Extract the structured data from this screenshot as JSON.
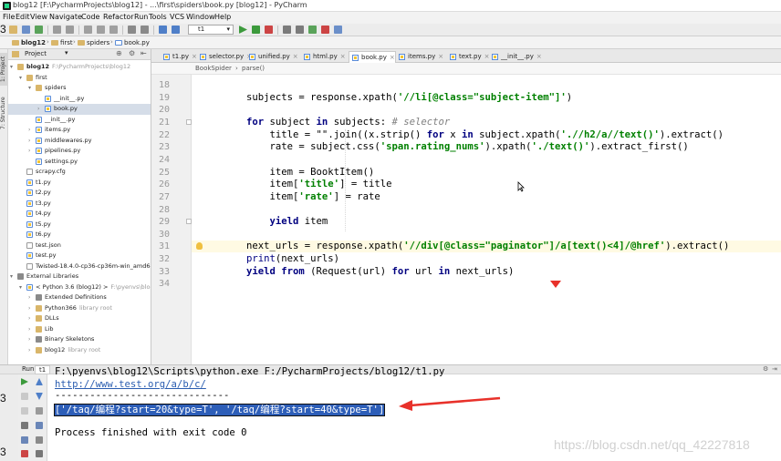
{
  "window": {
    "title": "blog12 [F:\\PycharmProjects\\blog12] - ...\\first\\spiders\\book.py [blog12] - PyCharm"
  },
  "menu": [
    "File",
    "Edit",
    "View",
    "Navigate",
    "Code",
    "Refactor",
    "Run",
    "Tools",
    "VCS",
    "Window",
    "Help"
  ],
  "toolbar": {
    "run_config": "t1"
  },
  "navbar": {
    "crumbs": [
      "blog12",
      "first",
      "spiders",
      "book.py"
    ]
  },
  "left_strip": {
    "tabs": [
      "1: Project",
      "7: Structure"
    ]
  },
  "project_panel": {
    "header": "Project",
    "tree": [
      {
        "label": "blog12",
        "suffix": "F:\\PycharmProjects\\blog12",
        "icon": "folder-icon",
        "depth": 0,
        "arrow": "down"
      },
      {
        "label": "first",
        "icon": "folder-icon",
        "depth": 1,
        "arrow": "down"
      },
      {
        "label": "spiders",
        "icon": "folder-icon",
        "depth": 2,
        "arrow": "down"
      },
      {
        "label": "__init__.py",
        "icon": "python-file-icon",
        "depth": 3
      },
      {
        "label": "book.py",
        "icon": "python-file-icon",
        "depth": 3,
        "selected": true,
        "arrow": "right"
      },
      {
        "label": "__init__.py",
        "icon": "python-file-icon",
        "depth": 2
      },
      {
        "label": "items.py",
        "icon": "python-file-icon",
        "depth": 2,
        "arrow": "right"
      },
      {
        "label": "middlewares.py",
        "icon": "python-file-icon",
        "depth": 2,
        "arrow": "right"
      },
      {
        "label": "pipelines.py",
        "icon": "python-file-icon",
        "depth": 2,
        "arrow": "right"
      },
      {
        "label": "settings.py",
        "icon": "python-file-icon",
        "depth": 2
      },
      {
        "label": "scrapy.cfg",
        "icon": "file-icon",
        "depth": 1
      },
      {
        "label": "t1.py",
        "icon": "python-file-icon",
        "depth": 1
      },
      {
        "label": "t2.py",
        "icon": "python-file-icon",
        "depth": 1
      },
      {
        "label": "t3.py",
        "icon": "python-file-icon",
        "depth": 1
      },
      {
        "label": "t4.py",
        "icon": "python-file-icon",
        "depth": 1
      },
      {
        "label": "t5.py",
        "icon": "python-file-icon",
        "depth": 1
      },
      {
        "label": "t6.py",
        "icon": "python-file-icon",
        "depth": 1
      },
      {
        "label": "test.json",
        "icon": "file-icon",
        "depth": 1
      },
      {
        "label": "test.py",
        "icon": "python-file-icon",
        "depth": 1
      },
      {
        "label": "Twisted-18.4.0-cp36-cp36m-win_amd64.whl",
        "icon": "file-icon",
        "depth": 1
      },
      {
        "label": "External Libraries",
        "icon": "library-icon",
        "depth": 0,
        "arrow": "down"
      },
      {
        "label": "< Python 3.6 (blog12) >",
        "suffix": "F:\\pyenvs\\blog12\\",
        "icon": "python-sdk-icon",
        "depth": 1,
        "arrow": "down"
      },
      {
        "label": "Extended Definitions",
        "icon": "library-icon",
        "depth": 2,
        "arrow": "right"
      },
      {
        "label": "Python366",
        "suffix": "library root",
        "icon": "folder-icon",
        "depth": 2,
        "arrow": "right"
      },
      {
        "label": "DLLs",
        "icon": "folder-icon",
        "depth": 2,
        "arrow": "right"
      },
      {
        "label": "Lib",
        "icon": "folder-icon",
        "depth": 2,
        "arrow": "right"
      },
      {
        "label": "Binary Skeletons",
        "icon": "library-icon",
        "depth": 2,
        "arrow": "right"
      },
      {
        "label": "blog12",
        "suffix": "library root",
        "icon": "folder-icon",
        "depth": 2,
        "arrow": "right"
      }
    ]
  },
  "editor": {
    "tabs": [
      {
        "label": "t1.py",
        "active": false
      },
      {
        "label": "selector.py",
        "active": false
      },
      {
        "label": "unified.py",
        "active": false
      },
      {
        "label": "html.py",
        "active": false
      },
      {
        "label": "book.py",
        "active": true
      },
      {
        "label": "items.py",
        "active": false
      },
      {
        "label": "text.py",
        "active": false
      },
      {
        "label": "__init__.py",
        "active": false
      }
    ],
    "breadcrumb": [
      "BookSpider",
      "parse()"
    ],
    "lines": [
      {
        "n": "18",
        "code": ""
      },
      {
        "n": "19",
        "code": "subjects = response.xpath('//li[@class=\"subject-item\"]')"
      },
      {
        "n": "20",
        "code": ""
      },
      {
        "n": "21",
        "code": "for subject in subjects: # selector"
      },
      {
        "n": "22",
        "code": "    title = \"\".join((x.strip() for x in subject.xpath('.//h2/a//text()').extract()"
      },
      {
        "n": "23",
        "code": "    rate = subject.css('span.rating_nums').xpath('./text()').extract_first()"
      },
      {
        "n": "24",
        "code": ""
      },
      {
        "n": "25",
        "code": "    item = BooktItem()"
      },
      {
        "n": "26",
        "code": "    item['title'] = title"
      },
      {
        "n": "27",
        "code": "    item['rate'] = rate"
      },
      {
        "n": "28",
        "code": ""
      },
      {
        "n": "29",
        "code": "    yield item"
      },
      {
        "n": "30",
        "code": ""
      },
      {
        "n": "31",
        "code": "next_urls = response.xpath('//div[@class=\"paginator\"]/a[text()<4]/@href').extract()"
      },
      {
        "n": "32",
        "code": "print(next_urls)"
      },
      {
        "n": "33",
        "code": "yield from (Request(url) for url in next_urls)"
      },
      {
        "n": "34",
        "code": ""
      }
    ]
  },
  "run_panel": {
    "header": "Run",
    "tab_label": "t1",
    "output": [
      "F:\\pyenvs\\blog12\\Scripts\\python.exe F:/PycharmProjects/blog12/t1.py",
      "http://www.test.org/a/b/c/",
      "------------------------------",
      "['/taq/编程?start=20&type=T', '/taq/编程?start=40&type=T']",
      "",
      "Process finished with exit code 0"
    ]
  },
  "watermark": "https://blog.csdn.net/qq_42227818",
  "edge_numbers": [
    "3",
    "3",
    "3"
  ],
  "colors": {
    "keyword": "#000080",
    "string": "#008000",
    "comment": "#808080",
    "selection": "#2d5eb8",
    "annotation": "#e8312a"
  }
}
